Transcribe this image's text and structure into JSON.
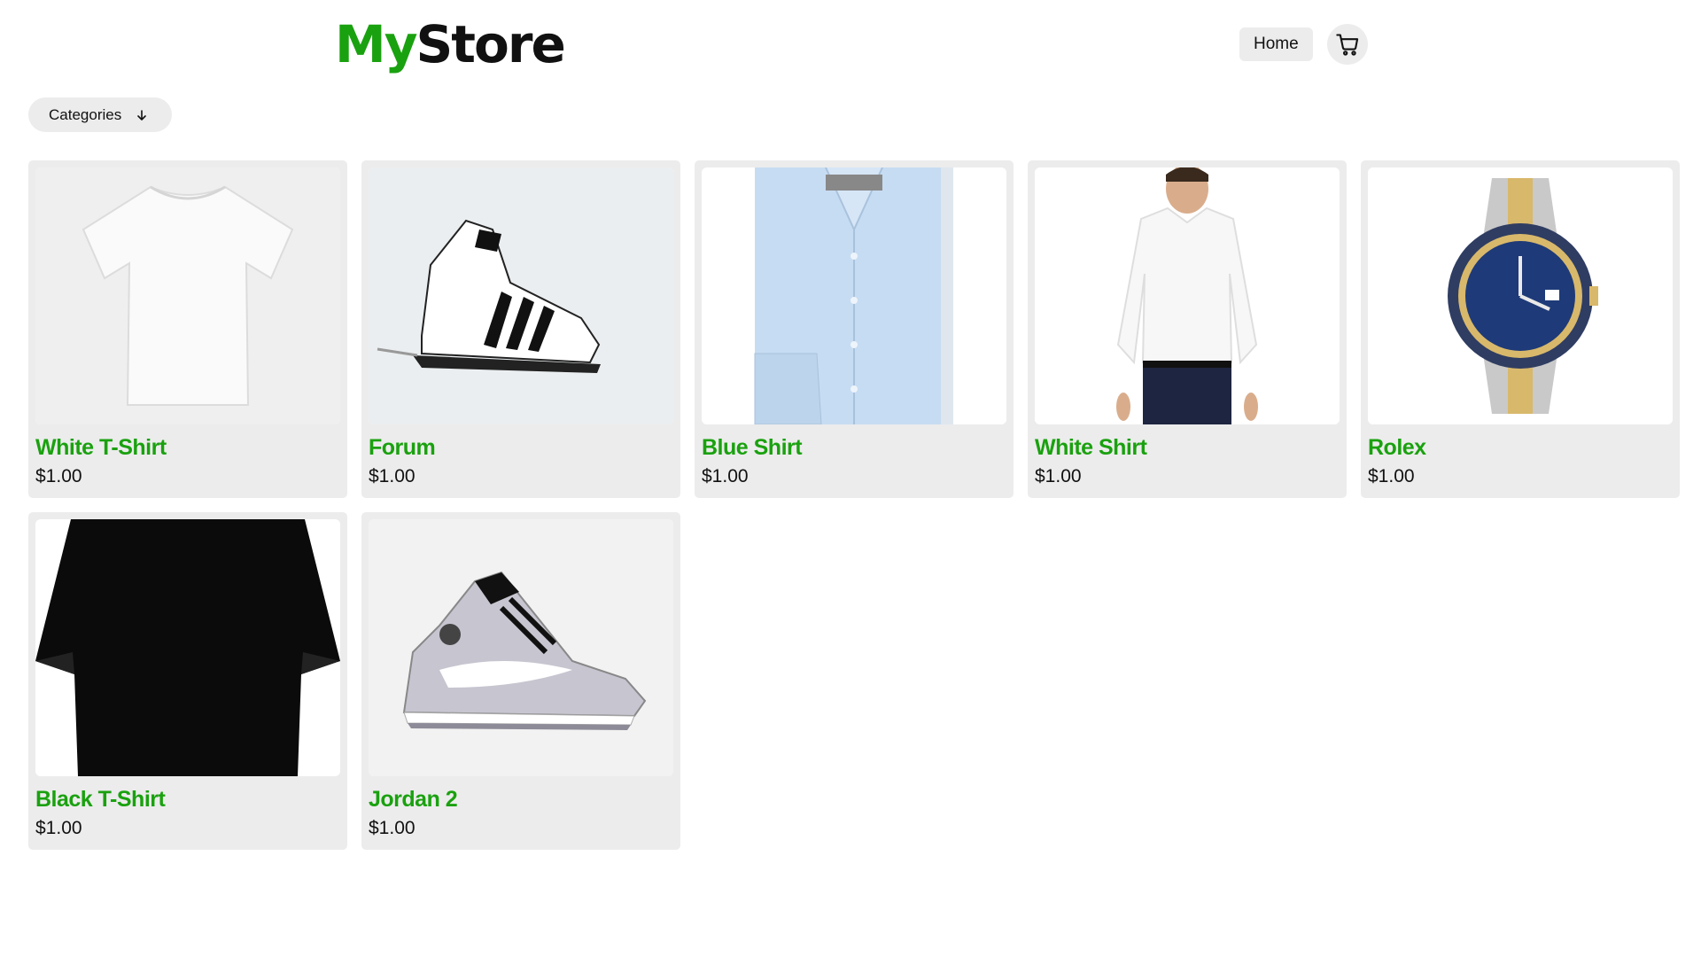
{
  "brand": {
    "part1": "My",
    "part2": "Store"
  },
  "nav": {
    "home_label": "Home",
    "cart_icon": "cart-icon"
  },
  "filter": {
    "categories_label": "Categories",
    "icon": "arrow-down-icon"
  },
  "products": [
    {
      "name": "White T-Shirt",
      "price": "$1.00",
      "image": "white-tshirt"
    },
    {
      "name": "Forum",
      "price": "$1.00",
      "image": "white-sneaker"
    },
    {
      "name": "Blue Shirt",
      "price": "$1.00",
      "image": "blue-shirt"
    },
    {
      "name": "White Shirt",
      "price": "$1.00",
      "image": "man-white-shirt"
    },
    {
      "name": "Rolex",
      "price": "$1.00",
      "image": "watch"
    },
    {
      "name": "Black T-Shirt",
      "price": "$1.00",
      "image": "black-tshirt"
    },
    {
      "name": "Jordan 2",
      "price": "$1.00",
      "image": "grey-sneaker"
    }
  ],
  "colors": {
    "accent": "#1aa10f",
    "card_bg": "#ececec",
    "text": "#111111"
  }
}
